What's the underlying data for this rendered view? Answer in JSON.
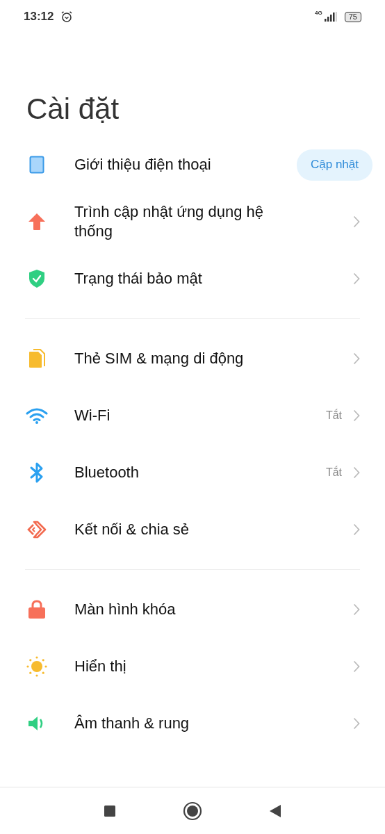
{
  "status_bar": {
    "time": "13:12",
    "network": "4G",
    "battery": "75"
  },
  "title": "Cài đặt",
  "sections": [
    {
      "items": [
        {
          "label": "Giới thiệu điện thoại",
          "kind": "action",
          "action": "Cập nhật"
        },
        {
          "label": "Trình cập nhật ứng dụng hệ thống",
          "kind": "link"
        },
        {
          "label": "Trạng thái bảo mật",
          "kind": "link"
        }
      ]
    },
    {
      "items": [
        {
          "label": "Thẻ SIM & mạng di động",
          "kind": "link"
        },
        {
          "label": "Wi-Fi",
          "kind": "link",
          "value": "Tắt"
        },
        {
          "label": "Bluetooth",
          "kind": "link",
          "value": "Tắt"
        },
        {
          "label": "Kết nối & chia sẻ",
          "kind": "link"
        }
      ]
    },
    {
      "items": [
        {
          "label": "Màn hình khóa",
          "kind": "link"
        },
        {
          "label": "Hiển thị",
          "kind": "link"
        },
        {
          "label": "Âm thanh & rung",
          "kind": "link"
        }
      ]
    }
  ]
}
